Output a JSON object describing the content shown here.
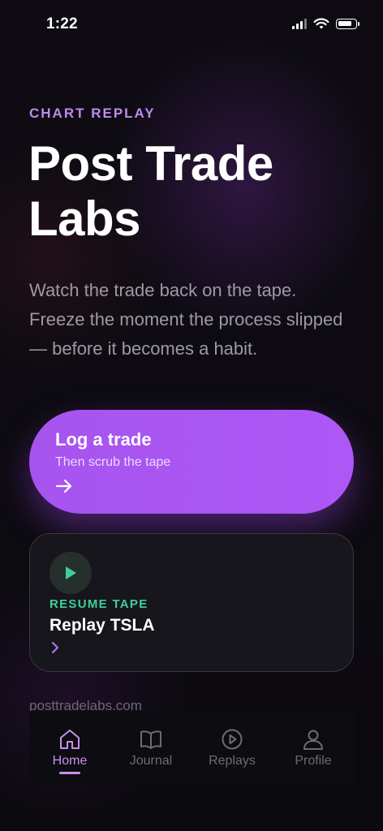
{
  "status_bar": {
    "time": "1:22",
    "icons": [
      "signal-icon",
      "wifi-icon",
      "battery-icon"
    ]
  },
  "hero": {
    "eyebrow": "CHART REPLAY",
    "title": "Post Trade Labs",
    "description": "Watch the trade back on the tape. Freeze the moment the process slipped — before it becomes a habit."
  },
  "primary_cta": {
    "title": "Log a trade",
    "subtitle": "Then scrub the tape",
    "icon": "arrow-right-icon"
  },
  "resume_card": {
    "label": "RESUME TAPE",
    "title": "Replay TSLA",
    "icon": "play-icon"
  },
  "footer": {
    "url": "posttradelabs.com"
  },
  "tab_bar": {
    "tabs": [
      {
        "label": "Home",
        "icon": "home-icon",
        "active": true
      },
      {
        "label": "Journal",
        "icon": "book-icon",
        "active": false
      },
      {
        "label": "Replays",
        "icon": "play-circle-icon",
        "active": false
      },
      {
        "label": "Profile",
        "icon": "user-icon",
        "active": false
      }
    ]
  },
  "colors": {
    "accent": "#ad57f6",
    "eyebrow": "#c08af0",
    "resume_green": "#3fcf9a",
    "background": "#0d0b11"
  }
}
